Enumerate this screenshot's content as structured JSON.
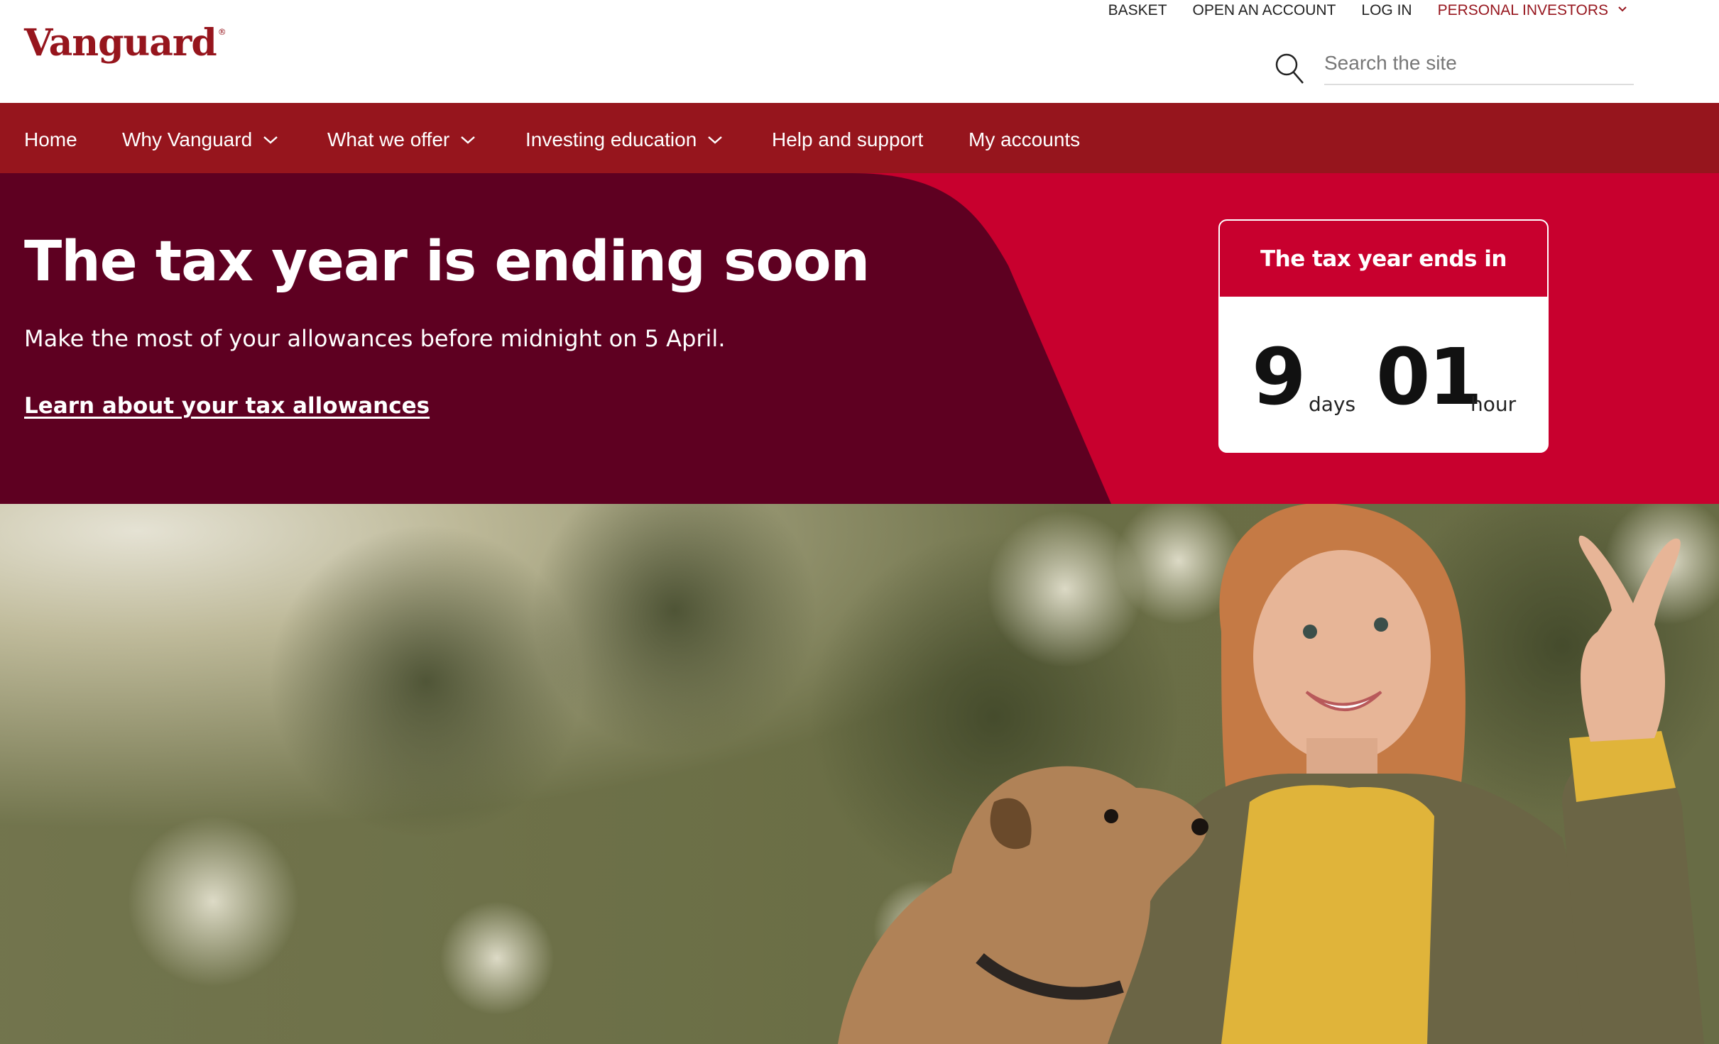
{
  "header": {
    "logo": "Vanguard",
    "logo_mark": "®",
    "utility": {
      "basket": "BASKET",
      "open_account": "OPEN AN ACCOUNT",
      "login": "LOG IN",
      "personal": "PERSONAL INVESTORS"
    },
    "search": {
      "placeholder": "Search the site",
      "value": ""
    }
  },
  "nav": {
    "items": [
      {
        "label": "Home",
        "has_dropdown": false
      },
      {
        "label": "Why Vanguard",
        "has_dropdown": true
      },
      {
        "label": "What we offer",
        "has_dropdown": true
      },
      {
        "label": "Investing education",
        "has_dropdown": true
      },
      {
        "label": "Help and support",
        "has_dropdown": false
      },
      {
        "label": "My accounts",
        "has_dropdown": false
      }
    ]
  },
  "hero": {
    "title": "The tax year is ending soon",
    "subtitle": "Make the most of your allowances before midnight on 5 April.",
    "link": "Learn about your tax allowances",
    "countdown": {
      "heading": "The tax year ends in",
      "days_value": "9",
      "days_unit": "days",
      "hours_value": "01",
      "hours_unit": "hour"
    }
  },
  "colors": {
    "brand": "#96151d",
    "hero_dark": "#5e0021",
    "hero_red": "#c8002e"
  },
  "icons": [
    "search-icon",
    "chevron-down-icon"
  ]
}
